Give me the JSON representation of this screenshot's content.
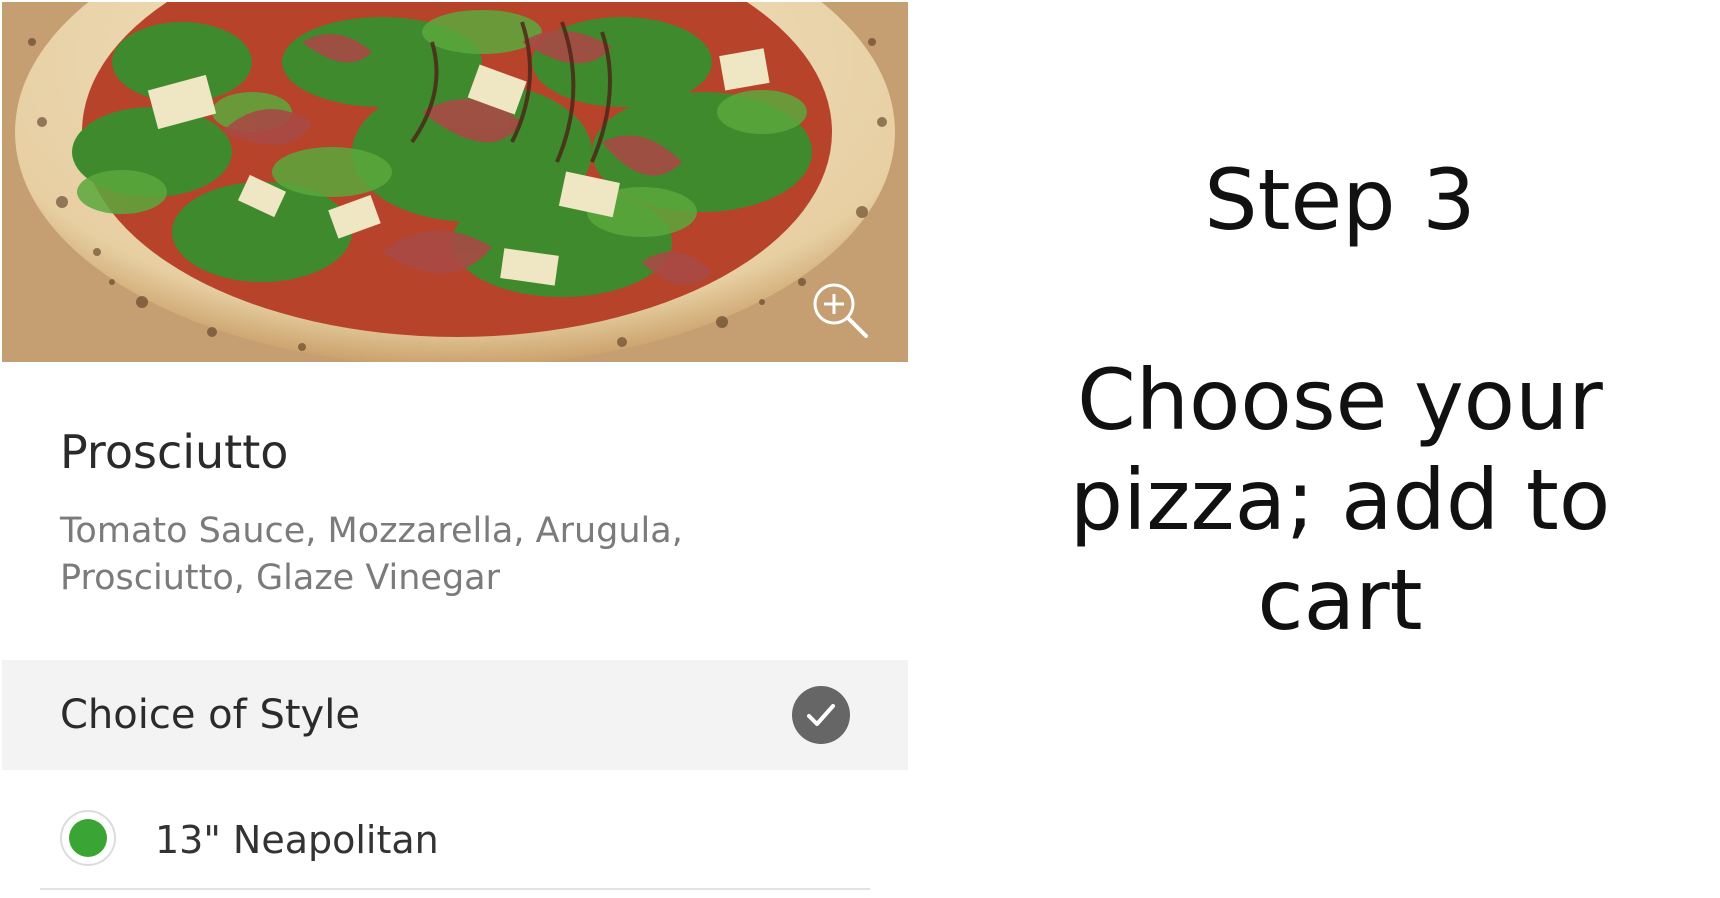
{
  "instruction": {
    "step": "Step 3",
    "text": "Choose your pizza; add to cart"
  },
  "item": {
    "name": "Prosciutto",
    "description": "Tomato Sauce, Mozzarella, Arugula, Prosciutto, Glaze Vinegar"
  },
  "hero": {
    "zoom_icon": "zoom-in-icon"
  },
  "style_section": {
    "title": "Choice of Style",
    "status_icon": "checkmark-icon",
    "options": [
      {
        "label": "13\" Neapolitan",
        "selected": true
      }
    ]
  },
  "colors": {
    "radio_selected": "#3aa535",
    "section_bg": "#f3f3f3",
    "check_badge": "#666666"
  }
}
